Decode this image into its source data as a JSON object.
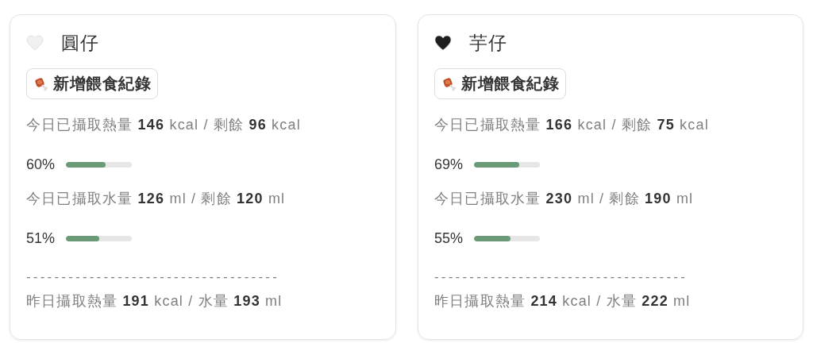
{
  "cards": [
    {
      "name": "圓仔",
      "color": "#f0f0f0",
      "button": "新增餵食紀錄",
      "calorie": {
        "summary": "今日已攝取熱量 **146** kcal / 剩餘 **96** kcal",
        "percent": "60%",
        "level": 0.6
      },
      "water": {
        "summary": "今日已攝取水量 **126** ml / 剩餘 **120** ml",
        "percent": "51%",
        "level": 0.51
      },
      "divider": "------------------------------------",
      "yesterday": "昨日攝取熱量 **191** kcal / 水量 **193** ml"
    },
    {
      "name": "芋仔",
      "color": "#1e1e1e",
      "button": "新增餵食紀錄",
      "calorie": {
        "summary": "今日已攝取熱量 **166** kcal / 剩餘 **75** kcal",
        "percent": "69%",
        "level": 0.69
      },
      "water": {
        "summary": "今日已攝取水量 **230** ml / 剩餘 **190** ml",
        "percent": "55%",
        "level": 0.55
      },
      "divider": "------------------------------------",
      "yesterday": "昨日攝取熱量 **214** kcal / 水量 **222** ml"
    }
  ]
}
